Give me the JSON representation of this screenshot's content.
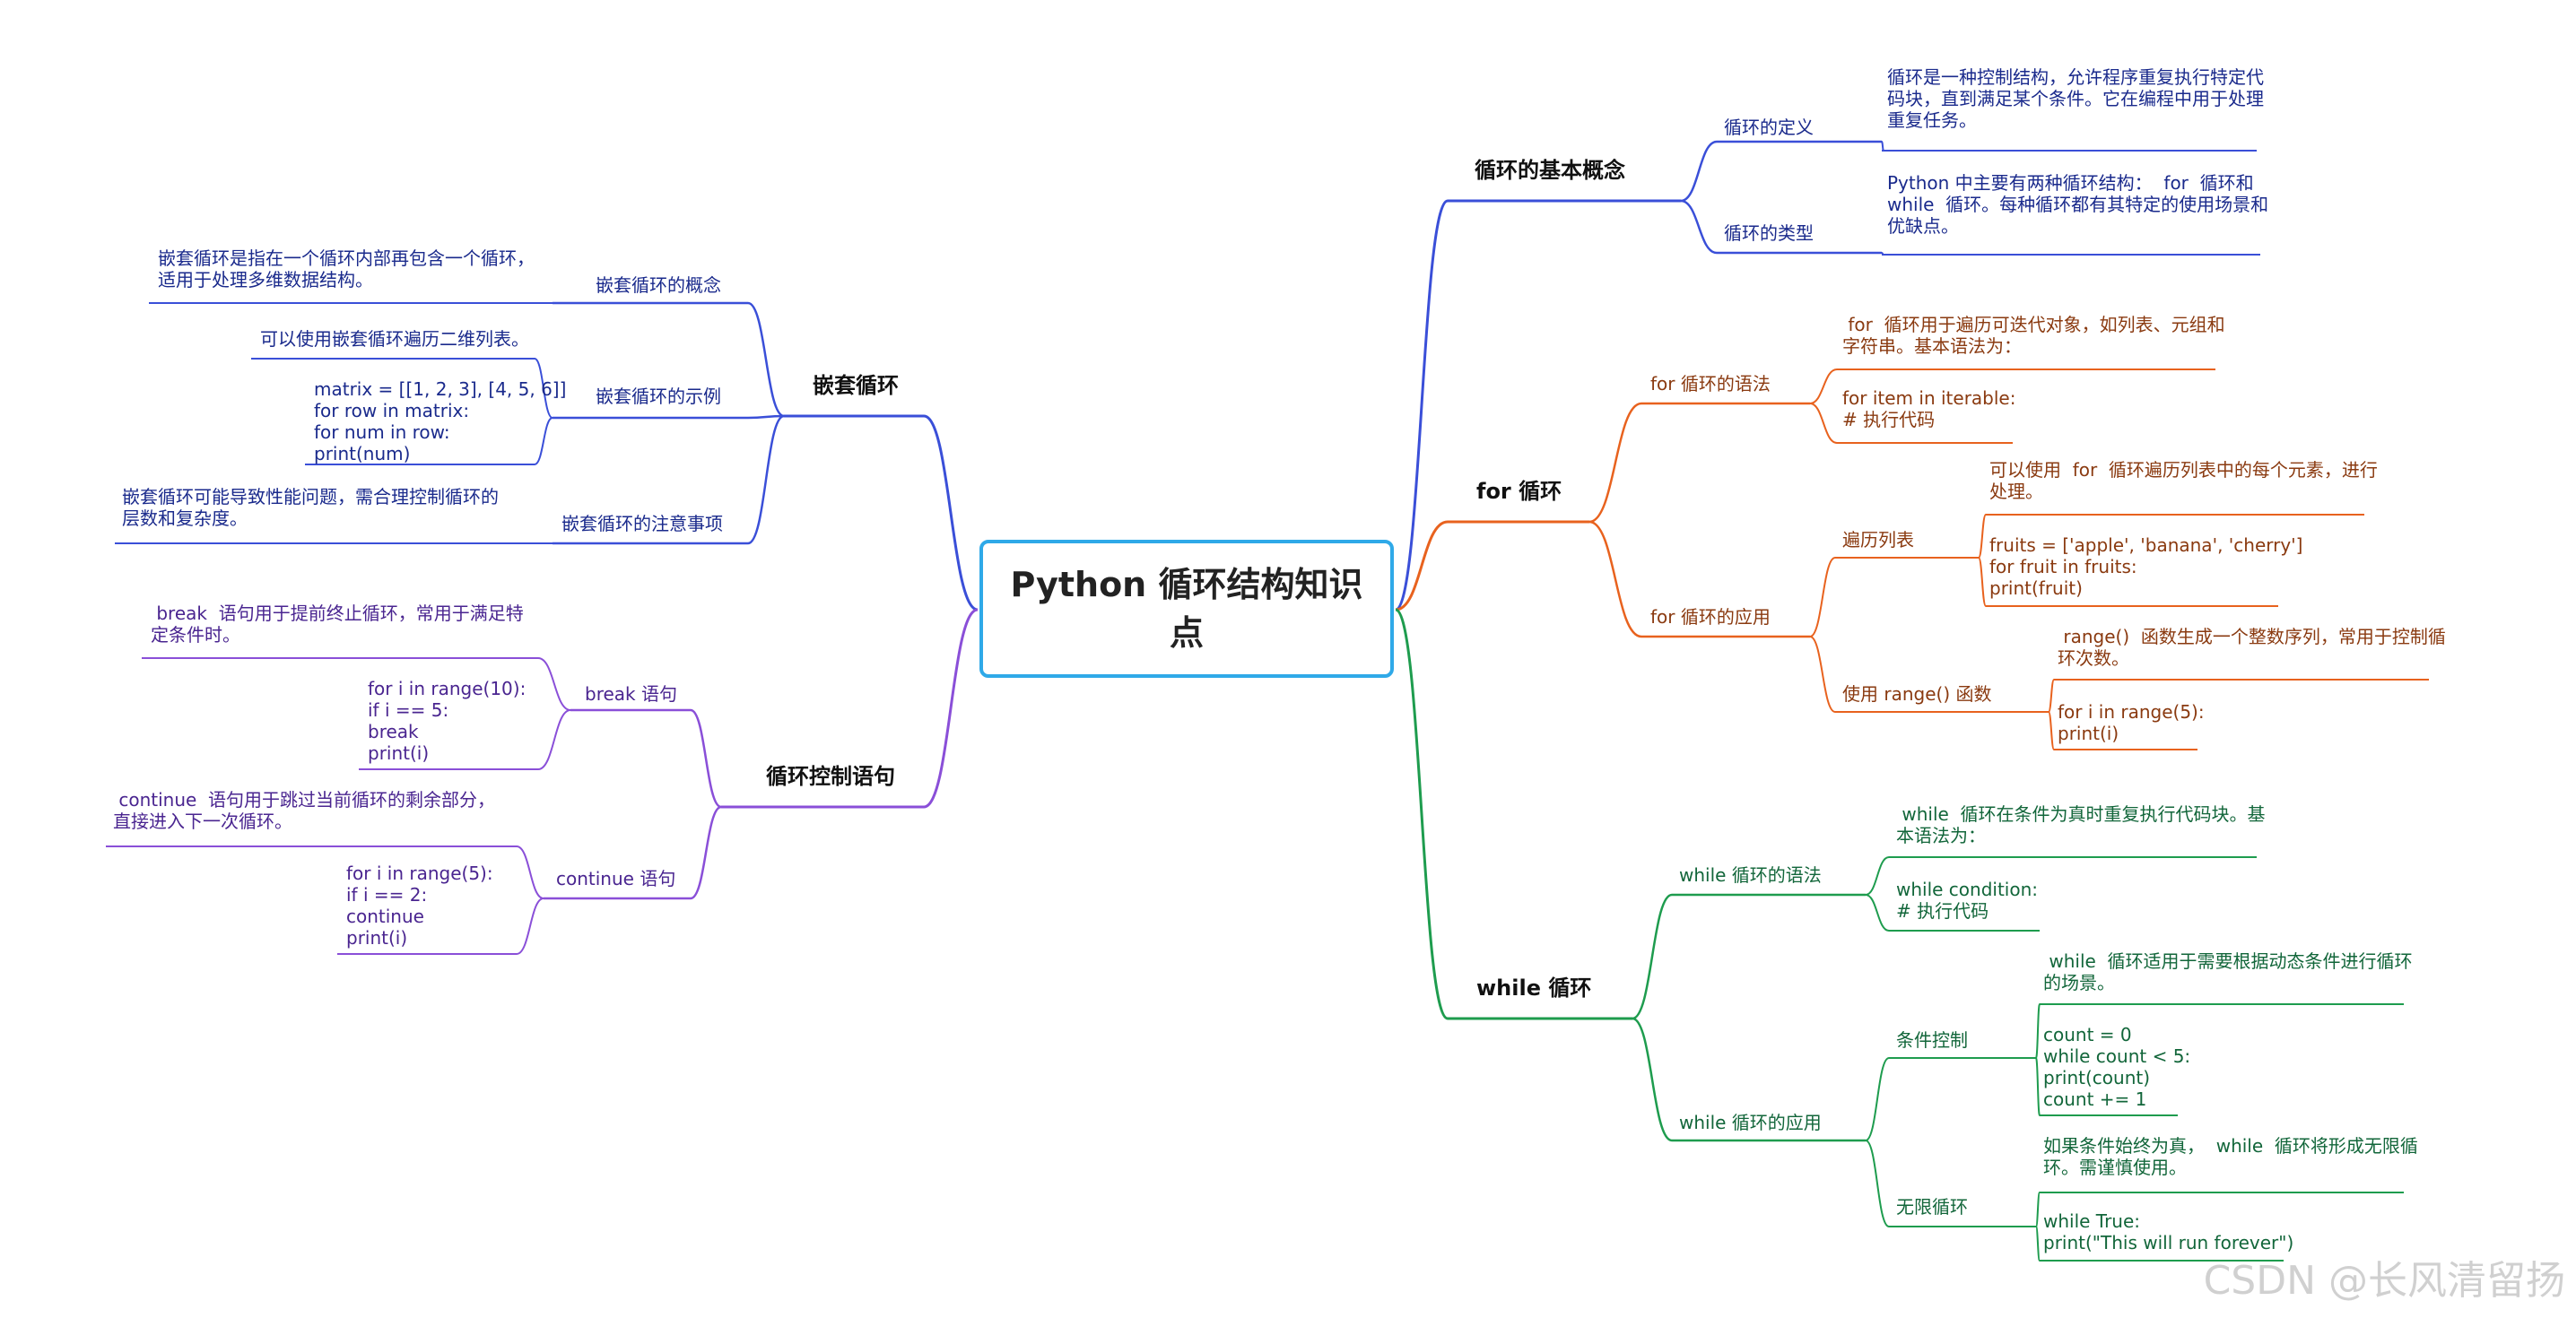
{
  "root": "Python 循环结构知识\n点",
  "watermark": "CSDN @长风清留扬",
  "colors": {
    "basic": "#3a4fd8",
    "for": "#e8621e",
    "while": "#1e9c4e",
    "nested": "#3a4fd8",
    "control": "#8a4fd8",
    "root_border": "#2fa9e8"
  },
  "branches": {
    "basic": {
      "label": "循环的基本概念",
      "definition": {
        "label": "循环的定义",
        "text": "循环是一种控制结构，允许程序重复执行特定代\n码块，直到满足某个条件。它在编程中用于处理\n重复任务。"
      },
      "types": {
        "label": "循环的类型",
        "text": "Python 中主要有两种循环结构：  for  循环和\nwhile  循环。每种循环都有其特定的使用场景和\n优缺点。"
      }
    },
    "for": {
      "label": "for 循环",
      "syntax": {
        "label": "for 循环的语法",
        "desc": " for  循环用于遍历可迭代对象，如列表、元组和\n字符串。基本语法为：",
        "code": "for item in iterable:\n# 执行代码"
      },
      "application": {
        "label": "for 循环的应用",
        "list": {
          "label": "遍历列表",
          "desc": "可以使用  for  循环遍历列表中的每个元素，进行\n处理。",
          "code": "fruits = ['apple', 'banana', 'cherry']\nfor fruit in fruits:\nprint(fruit)"
        },
        "range": {
          "label": "使用 range() 函数",
          "desc": " range()  函数生成一个整数序列，常用于控制循\n环次数。",
          "code": "for i in range(5):\nprint(i)"
        }
      }
    },
    "while": {
      "label": "while 循环",
      "syntax": {
        "label": "while 循环的语法",
        "desc": " while  循环在条件为真时重复执行代码块。基\n本语法为：",
        "code": "while condition:\n# 执行代码"
      },
      "application": {
        "label": "while 循环的应用",
        "condition": {
          "label": "条件控制",
          "desc": " while  循环适用于需要根据动态条件进行循环\n的场景。",
          "code": "count = 0\nwhile count < 5:\nprint(count)\ncount += 1"
        },
        "infinite": {
          "label": "无限循环",
          "desc": "如果条件始终为真，  while  循环将形成无限循\n环。需谨慎使用。",
          "code": "while True:\nprint(\"This will run forever\")"
        }
      }
    },
    "nested": {
      "label": "嵌套循环",
      "concept": {
        "label": "嵌套循环的概念",
        "text": "嵌套循环是指在一个循环内部再包含一个循环，\n适用于处理多维数据结构。"
      },
      "example": {
        "label": "嵌套循环的示例",
        "desc": "可以使用嵌套循环遍历二维列表。",
        "code": "matrix = [[1, 2, 3], [4, 5, 6]]\nfor row in matrix:\nfor num in row:\nprint(num)"
      },
      "notes": {
        "label": "嵌套循环的注意事项",
        "text": "嵌套循环可能导致性能问题，需合理控制循环的\n层数和复杂度。"
      }
    },
    "control": {
      "label": "循环控制语句",
      "break": {
        "label": "break 语句",
        "desc": " break  语句用于提前终止循环，常用于满足特\n定条件时。",
        "code": "for i in range(10):\nif i == 5:\nbreak\nprint(i)"
      },
      "continue": {
        "label": "continue 语句",
        "desc": " continue  语句用于跳过当前循环的剩余部分，\n直接进入下一次循环。",
        "code": "for i in range(5):\nif i == 2:\ncontinue\nprint(i)"
      }
    }
  }
}
